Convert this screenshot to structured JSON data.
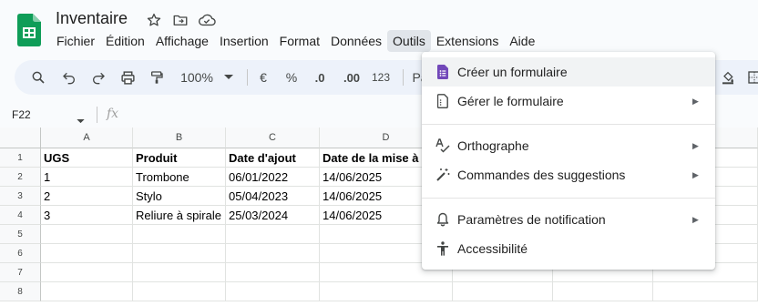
{
  "document": {
    "title": "Inventaire"
  },
  "menubar": [
    "Fichier",
    "Édition",
    "Affichage",
    "Insertion",
    "Format",
    "Données",
    "Outils",
    "Extensions",
    "Aide"
  ],
  "toolbar": {
    "zoom": "100%",
    "currency": "€",
    "percent": "%",
    "decimal_decrease": ".0",
    "decimal_increase": ".00",
    "number_format": "123",
    "partial_label": "Pa"
  },
  "formula_bar": {
    "cell_ref": "F22",
    "fx": "fx"
  },
  "grid": {
    "columns": [
      "A",
      "B",
      "C",
      "D"
    ],
    "rows": [
      "1",
      "2",
      "3",
      "4",
      "5",
      "6",
      "7",
      "8"
    ],
    "header_row": [
      "UGS",
      "Produit",
      "Date d'ajout",
      "Date de la mise à"
    ],
    "data": [
      [
        "1",
        "Trombone",
        "06/01/2022",
        "14/06/2025"
      ],
      [
        "2",
        "Stylo",
        "05/04/2023",
        "14/06/2025"
      ],
      [
        "3",
        "Reliure à spirale",
        "25/03/2024",
        "14/06/2025"
      ]
    ]
  },
  "outils_menu": {
    "items": [
      {
        "label": "Créer un formulaire",
        "icon": "forms-icon",
        "submenu": false
      },
      {
        "label": "Gérer le formulaire",
        "icon": "form-doc-icon",
        "submenu": true
      },
      {
        "label": "Orthographe",
        "icon": "spellcheck-icon",
        "submenu": true
      },
      {
        "label": "Commandes des suggestions",
        "icon": "magic-wand-icon",
        "submenu": true
      },
      {
        "label": "Paramètres de notification",
        "icon": "bell-icon",
        "submenu": true
      },
      {
        "label": "Accessibilité",
        "icon": "accessibility-icon",
        "submenu": false
      }
    ]
  },
  "colors": {
    "sheets_green": "#0f9d58",
    "forms_purple": "#7248b9",
    "toolbar_bg": "#edf2fa"
  }
}
